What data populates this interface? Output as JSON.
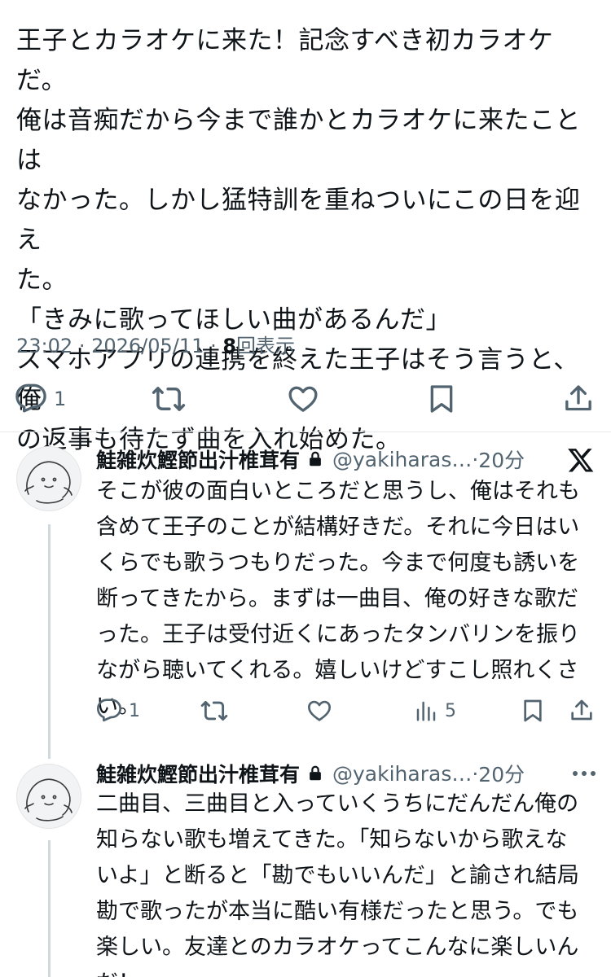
{
  "tweet": {
    "text": "王子とカラオケに来た！記念すべき初カラオケだ。\n俺は音痴だから今まで誰かとカラオケに来たことは\nなかった。しかし猛特訓を重ねついにこの日を迎え\nた。\n「きみに歌ってほしい曲があるんだ」\nスマホアプリの連携を終えた王子はそう言うと、俺\nの返事も待たず曲を入れ始めた。",
    "time": "23:02",
    "date": "2026/05/11",
    "separator": "·",
    "views_count": "8",
    "views_label": "回表示",
    "reply_count": "1"
  },
  "icons": {
    "reply": "reply-icon",
    "retweet": "retweet-icon",
    "like": "like-icon",
    "bookmark": "bookmark-icon",
    "share": "share-icon",
    "analytics": "analytics-icon",
    "lock": "lock-icon",
    "x_logo": "x-logo-icon",
    "more": "more-icon"
  },
  "replies": [
    {
      "name": "鮭雑炊鰹節出汁椎茸有",
      "handle": "@yakiharas…",
      "separator": "·",
      "time": "20分",
      "text": "そこが彼の面白いところだと思うし、俺はそれも\n含めて王子のことが結構好きだ。それに今日はい\nくらでも歌うつもりだった。今まで何度も誘いを\n断ってきたから。まずは一曲目、俺の好きな歌だ\nった。王子は受付近くにあったタンバリンを振り\nながら聴いてくれる。嬉しいけどすこし照れくさ\nい。",
      "reply_count": "1",
      "views_count": "5"
    },
    {
      "name": "鮭雑炊鰹節出汁椎茸有",
      "handle": "@yakiharas…",
      "separator": "·",
      "time": "20分",
      "text": "二曲目、三曲目と入っていくうちにだんだん俺の\n知らない歌も増えてきた。「知らないから歌えな\nいよ」と断ると「勘でもいいんだ」と諭され結局\n勘で歌ったが本当に酷い有様だったと思う。でも\n楽しい。友達とのカラオケってこんなに楽しいん\nだ！"
    }
  ],
  "colors": {
    "text": "#0f1419",
    "secondary": "#536471",
    "divider": "#e6e9eb",
    "thread_line": "#cfd9de"
  }
}
